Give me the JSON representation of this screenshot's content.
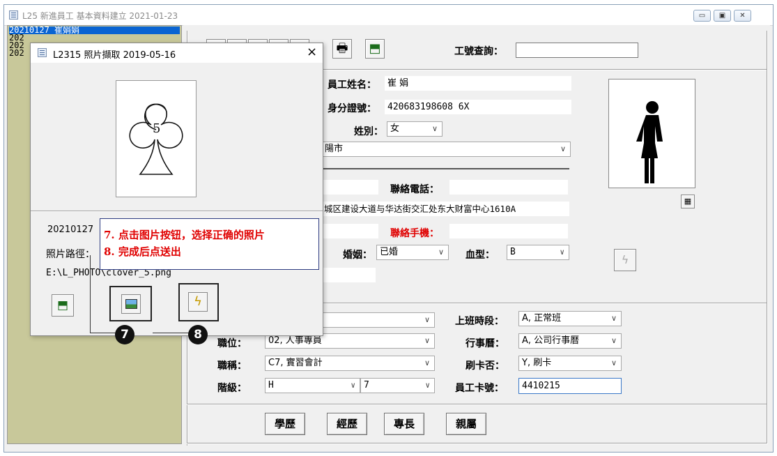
{
  "main_window": {
    "title": "L25 新進員工 基本資料建立 2021-01-23",
    "controls": {
      "minimize": "▭",
      "maximize": "▣",
      "close": "✕"
    }
  },
  "employee_list": [
    {
      "text": "20210127       崔娟娟",
      "selected": true
    },
    {
      "text": "202",
      "selected": false
    },
    {
      "text": "202",
      "selected": false
    },
    {
      "text": "202",
      "selected": false
    }
  ],
  "toolbar": {
    "print_icon": "🖶",
    "exit_icon": "⬒",
    "search_label": "工號查詢：",
    "search_value": ""
  },
  "form": {
    "name_label": "員工姓名：",
    "name_value": "崔        娟",
    "id_label": "身分證號：",
    "id_value": "420683198608    6X",
    "gender_label": "姓別：",
    "gender_value": "女",
    "city_value": "陽市",
    "phone_label": "聯絡電話：",
    "phone_value": "",
    "address_value": "城区建设大道与华达街交汇处东大财富中心1610A",
    "mobile_label": "聯絡手機：",
    "mobile_value": "",
    "marital_label": "婚姻：",
    "marital_value": "已婚",
    "blood_label": "血型：",
    "blood_value": "B"
  },
  "job": {
    "dept_value": "",
    "position_label": "職位：",
    "position_value": "02, 人事專員",
    "title_label": "職稱：",
    "title_value": "C7, 實習會計",
    "grade_label": "階級：",
    "grade_value": "H",
    "grade_sub_value": "7",
    "shift_label": "上班時段：",
    "shift_value": "A, 正常班",
    "calendar_label": "行事曆：",
    "calendar_value": "A, 公司行事曆",
    "card_label": "刷卡否：",
    "card_value": "Y, 刷卡",
    "card_no_label": "員工卡號：",
    "card_no_value": "4410215"
  },
  "bottom_buttons": [
    "學歷",
    "經歷",
    "專長",
    "親屬"
  ],
  "dialog": {
    "title": "L2315 照片擷取 2019-05-16",
    "close": "×",
    "emp_id": "20210127",
    "path_label": "照片路徑：",
    "path_value": "E:\\L_PHOTO\\clover_5.png"
  },
  "callout": {
    "line1": "7. 点击图片按钮，选择正确的照片",
    "line2": "8. 完成后点送出"
  },
  "badges": [
    "7",
    "8"
  ]
}
